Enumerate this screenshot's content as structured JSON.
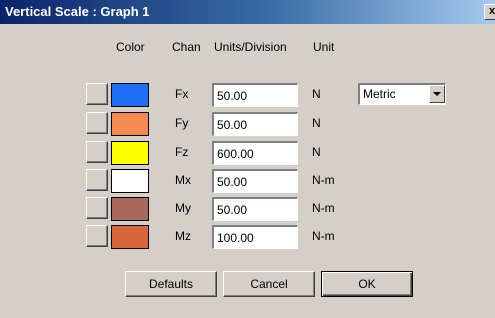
{
  "window": {
    "title": "Vertical Scale : Graph 1",
    "close_label": "x"
  },
  "headers": {
    "color": "Color",
    "chan": "Chan",
    "units_division": "Units/Division",
    "unit": "Unit"
  },
  "rows": [
    {
      "chan": "Fx",
      "value": "50.00",
      "unit": "N",
      "color": "#1e6ff5"
    },
    {
      "chan": "Fy",
      "value": "50.00",
      "unit": "N",
      "color": "#f58a50"
    },
    {
      "chan": "Fz",
      "value": "600.00",
      "unit": "N",
      "color": "#ffff00"
    },
    {
      "chan": "Mx",
      "value": "50.00",
      "unit": "N-m",
      "color": "#ffffff"
    },
    {
      "chan": "My",
      "value": "50.00",
      "unit": "N-m",
      "color": "#a8685a"
    },
    {
      "chan": "Mz",
      "value": "100.00",
      "unit": "N-m",
      "color": "#d8683a"
    }
  ],
  "unit_system": {
    "selected": "Metric"
  },
  "buttons": {
    "defaults": "Defaults",
    "cancel": "Cancel",
    "ok": "OK"
  }
}
